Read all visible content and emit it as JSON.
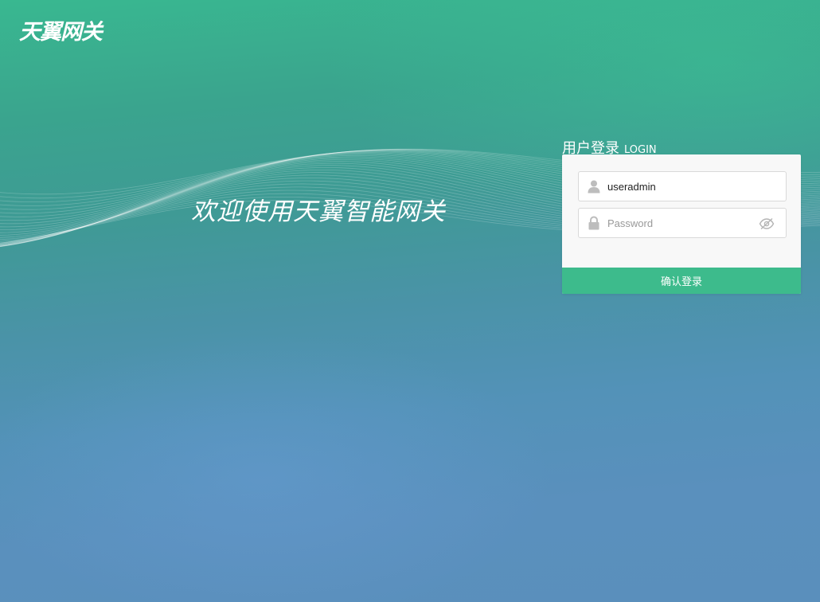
{
  "brand": {
    "logo_text": "天翼网关"
  },
  "welcome": {
    "text": "欢迎使用天翼智能网关"
  },
  "login": {
    "heading_zh": "用户登录",
    "heading_en": "LOGIN",
    "username_value": "useradmin",
    "password_placeholder": "Password",
    "submit_label": "确认登录",
    "icons": {
      "user": "user-icon",
      "password": "lock-icon",
      "toggle": "eye-slash-icon"
    }
  },
  "colors": {
    "accent": "#3dbb8c",
    "bg_top": "#39b890",
    "bg_bottom": "#5a8fbc"
  }
}
